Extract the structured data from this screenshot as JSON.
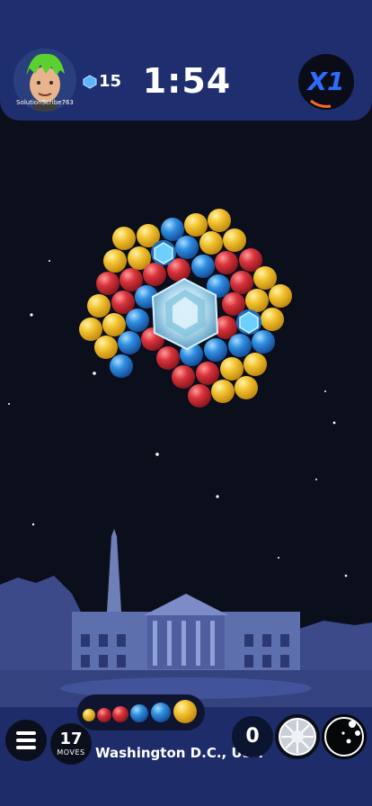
{
  "header": {
    "username": "SolutionScribe763",
    "gems": "15",
    "timer": "1:54",
    "multiplier": "X1"
  },
  "footer": {
    "moves_count": "17",
    "moves_label": "MOVES",
    "location": "Washington D.C., USA",
    "score": "0"
  },
  "colors": {
    "yellow": "#f2c230",
    "red": "#d8333b",
    "blue": "#2f8ee0",
    "header_bg": "#1f2e6e",
    "footer_bg": "#1e2d6a",
    "multiplier": "#2f6bff"
  },
  "queue": [
    "yellow",
    "red",
    "red",
    "blue",
    "blue",
    "yellow"
  ]
}
